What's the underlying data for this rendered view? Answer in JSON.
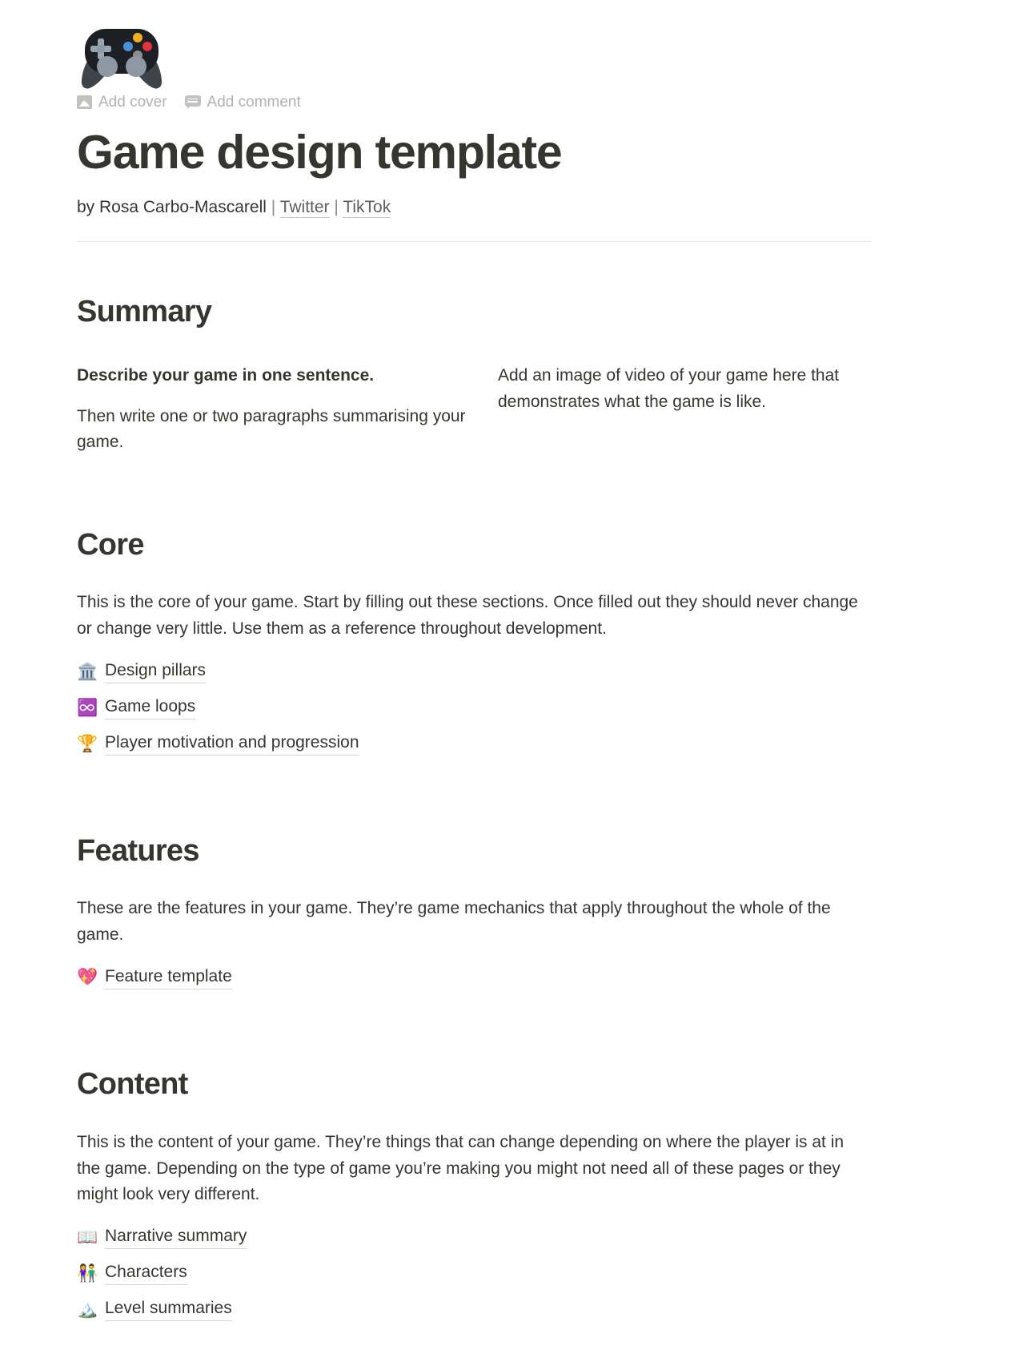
{
  "page": {
    "icon": "gamepad-emoji",
    "title": "Game design template",
    "byline": {
      "prefix": "by Rosa Carbo-Mascarell",
      "separator": "|",
      "links": [
        {
          "label": "Twitter"
        },
        {
          "label": "TikTok"
        }
      ]
    }
  },
  "meta_actions": [
    {
      "icon": "image-icon",
      "label": "Add cover"
    },
    {
      "icon": "comment-icon",
      "label": "Add comment"
    }
  ],
  "sections": [
    {
      "id": "summary",
      "heading": "Summary",
      "left_column": [
        "Describe your game in one sentence.",
        "Then write one or two paragraphs summarising your game."
      ],
      "right_column": [
        "Add an image of video of your game here that demonstrates what the game is like."
      ]
    },
    {
      "id": "core",
      "heading": "Core",
      "paragraph": "This is the core of your game. Start by filling out these sections. Once filled out they should never change or change very little. Use them as a reference throughout development.",
      "links": [
        {
          "emoji": "🏛️",
          "icon_name": "classical-building-icon",
          "label": "Design pillars"
        },
        {
          "emoji": "♾️",
          "icon_name": "infinity-icon",
          "label": "Game loops"
        },
        {
          "emoji": "🏆",
          "icon_name": "trophy-icon",
          "label": "Player motivation and progression"
        }
      ]
    },
    {
      "id": "features",
      "heading": "Features",
      "paragraph": "These are the features in your game. They’re game mechanics that apply throughout the whole of the game.",
      "links": [
        {
          "emoji": "💖",
          "icon_name": "sparkling-heart-icon",
          "label": "Feature template"
        }
      ]
    },
    {
      "id": "content",
      "heading": "Content",
      "paragraph": "This is the content of your game. They’re things that can change depending on where the player is at in the game. Depending on the type of game you’re making you might not need all of these pages or they might look very different.",
      "links": [
        {
          "emoji": "📖",
          "icon_name": "open-book-icon",
          "label": "Narrative summary"
        },
        {
          "emoji": "👫",
          "icon_name": "people-holding-hands-icon",
          "label": "Characters"
        },
        {
          "emoji": "🏔️",
          "icon_name": "mountain-icon",
          "label": "Level summaries"
        }
      ]
    }
  ],
  "colors": {
    "text": "#37352f",
    "muted": "#b4b2ad",
    "divider": "#e9e9e7",
    "underline": "#d4d3cf"
  }
}
